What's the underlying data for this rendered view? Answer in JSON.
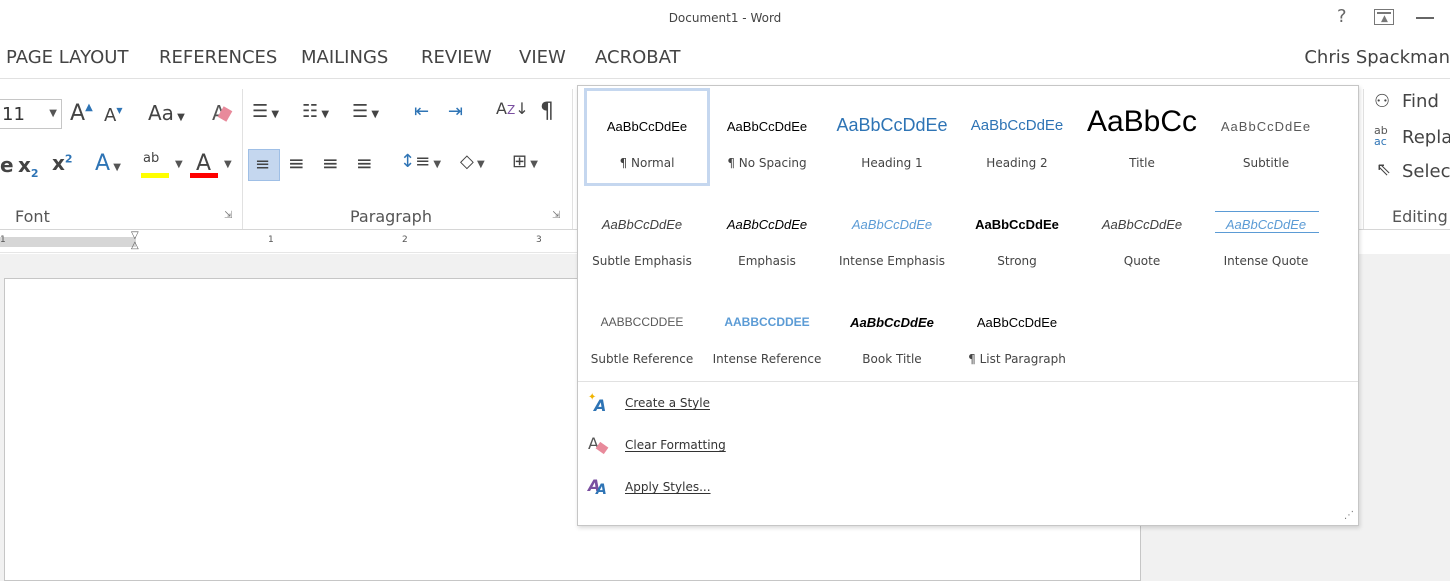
{
  "window": {
    "title": "Document1 - Word",
    "help_glyph": "?",
    "restore_glyph": "⤒",
    "minimize_glyph": "—"
  },
  "tabs": [
    "PAGE LAYOUT",
    "REFERENCES",
    "MAILINGS",
    "REVIEW",
    "VIEW",
    "ACROBAT"
  ],
  "user": "Chris Spackman",
  "ribbon": {
    "font_size": "11",
    "font_group_label": "Font",
    "paragraph_group_label": "Paragraph",
    "editing_group_label": "Editing",
    "change_case_label": "Aa",
    "editing": {
      "find_label": "Find",
      "replace_label": "Replace",
      "select_label": "Select"
    }
  },
  "ruler": {
    "marks": [
      "1",
      "1",
      "2",
      "3"
    ]
  },
  "styles_gallery": {
    "tiles": [
      {
        "sample": "AaBbCcDdEe",
        "name": "¶ Normal"
      },
      {
        "sample": "AaBbCcDdEe",
        "name": "¶ No Spacing"
      },
      {
        "sample": "AaBbCcDdEe",
        "name": "Heading 1"
      },
      {
        "sample": "AaBbCcDdEe",
        "name": "Heading 2"
      },
      {
        "sample": "AaBbCc",
        "name": "Title"
      },
      {
        "sample": "AaBbCcDdEe",
        "name": "Subtitle"
      },
      {
        "sample": "AaBbCcDdEe",
        "name": "Subtle Emphasis"
      },
      {
        "sample": "AaBbCcDdEe",
        "name": "Emphasis"
      },
      {
        "sample": "AaBbCcDdEe",
        "name": "Intense Emphasis"
      },
      {
        "sample": "AaBbCcDdEe",
        "name": "Strong"
      },
      {
        "sample": "AaBbCcDdEe",
        "name": "Quote"
      },
      {
        "sample": "AaBbCcDdEe",
        "name": "Intense Quote"
      },
      {
        "sample": "AABBCCDDEE",
        "name": "Subtle Reference"
      },
      {
        "sample": "AABBCCDDEE",
        "name": "Intense Reference"
      },
      {
        "sample": "AaBbCcDdEe",
        "name": "Book Title"
      },
      {
        "sample": "AaBbCcDdEe",
        "name": "¶ List Paragraph"
      }
    ],
    "selected_index": 0
  },
  "menu": {
    "create_style": "Create a Style",
    "clear_formatting": "Clear Formatting",
    "apply_styles": "Apply Styles..."
  },
  "colors": {
    "accent_blue": "#2e74b5",
    "heading_blue": "#4a7ebb",
    "highlight_yellow": "#ffff00",
    "font_red": "#ff0000",
    "selection": "#c5d7ef"
  }
}
